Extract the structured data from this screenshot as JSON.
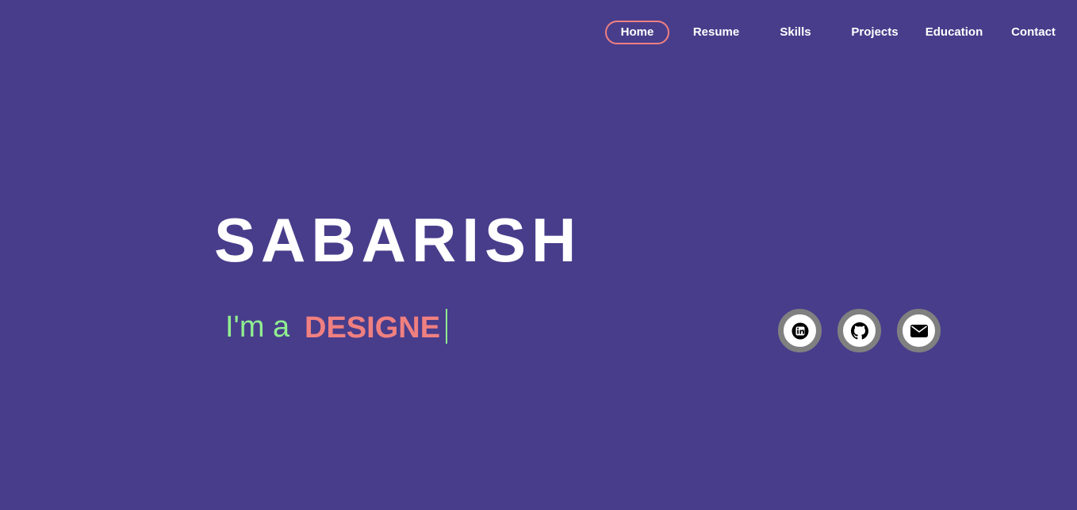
{
  "nav": {
    "items": [
      {
        "label": "Home",
        "active": true
      },
      {
        "label": "Resume",
        "active": false
      },
      {
        "label": "Skills",
        "active": false
      },
      {
        "label": "Projects",
        "active": false
      },
      {
        "label": "Education",
        "active": false
      },
      {
        "label": "Contact",
        "active": false
      }
    ]
  },
  "hero": {
    "name": "SABARISH",
    "tagline_prefix": "I'm a",
    "tagline_role": "DESIGNE"
  },
  "social": [
    {
      "icon": "linkedin-icon"
    },
    {
      "icon": "github-icon"
    },
    {
      "icon": "mail-icon"
    }
  ],
  "colors": {
    "background": "#483d8b",
    "accent": "#f08080",
    "tagline_prefix": "#90ee90",
    "social_ring": "#808080"
  }
}
